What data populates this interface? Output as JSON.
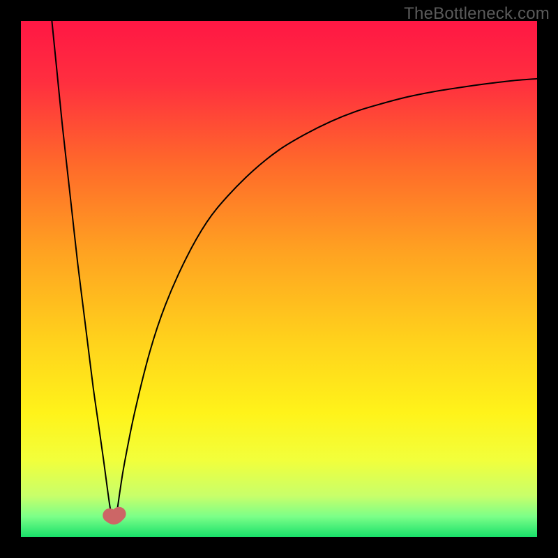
{
  "watermark": "TheBottleneck.com",
  "chart_data": {
    "type": "line",
    "title": "",
    "xlabel": "",
    "ylabel": "",
    "xlim": [
      0,
      100
    ],
    "ylim": [
      0,
      100
    ],
    "grid": false,
    "legend": false,
    "background_gradient": {
      "stops": [
        {
          "offset": 0.0,
          "color": "#ff1744"
        },
        {
          "offset": 0.12,
          "color": "#ff2f3f"
        },
        {
          "offset": 0.28,
          "color": "#ff6a2a"
        },
        {
          "offset": 0.45,
          "color": "#ffa321"
        },
        {
          "offset": 0.62,
          "color": "#ffd21c"
        },
        {
          "offset": 0.76,
          "color": "#fff31a"
        },
        {
          "offset": 0.85,
          "color": "#f2ff3b"
        },
        {
          "offset": 0.92,
          "color": "#c8ff6a"
        },
        {
          "offset": 0.96,
          "color": "#7cff88"
        },
        {
          "offset": 1.0,
          "color": "#18e06a"
        }
      ]
    },
    "series": [
      {
        "name": "bottleneck-curve",
        "color": "#000000",
        "stroke_width": 2,
        "optimum_x": 18,
        "x": [
          6,
          7,
          8,
          9,
          10,
          11,
          12,
          13,
          14,
          15,
          16,
          16.8,
          17.4,
          18,
          18.6,
          19.2,
          20,
          22,
          25,
          28,
          32,
          36,
          40,
          45,
          50,
          55,
          60,
          65,
          70,
          75,
          80,
          85,
          90,
          95,
          100
        ],
        "y": [
          100,
          90,
          80,
          71,
          62,
          53,
          45,
          37,
          29,
          22,
          15,
          9,
          5,
          3,
          5,
          9,
          14,
          24,
          36,
          45,
          54,
          61,
          66,
          71,
          75,
          78,
          80.5,
          82.5,
          84,
          85.3,
          86.3,
          87.1,
          87.8,
          88.4,
          88.8
        ]
      }
    ],
    "marker": {
      "name": "optimum-marker",
      "color": "#cc6666",
      "points": [
        {
          "x": 17.2,
          "y": 4.2
        },
        {
          "x": 19.0,
          "y": 4.5
        }
      ],
      "radius": 10,
      "bridge": true
    }
  }
}
